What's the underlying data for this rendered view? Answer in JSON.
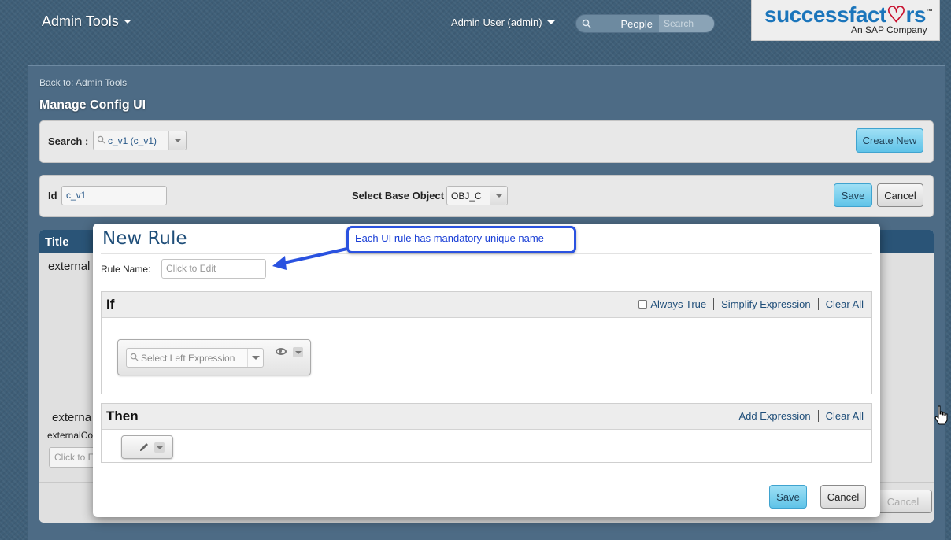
{
  "header": {
    "admin_tools": "Admin Tools",
    "user_menu": "Admin User (admin)",
    "people_label": "People",
    "search_placeholder": "Search",
    "logo_main_a": "successfact",
    "logo_main_b": "rs",
    "logo_sub": "An SAP Company"
  },
  "page": {
    "back_link": "Back to: Admin Tools",
    "title": "Manage Config UI"
  },
  "search_bar": {
    "label": "Search :",
    "value": "c_v1 (c_v1)",
    "create_new": "Create New"
  },
  "id_bar": {
    "id_label": "Id",
    "id_value": "c_v1",
    "base_object_label": "Select Base Object",
    "base_object_value": "OBJ_C",
    "save": "Save",
    "cancel": "Cancel"
  },
  "background_section": {
    "title": "Title",
    "external_1": "external",
    "external_2": "externa",
    "external_3": "externalCo",
    "input_placeholder": "Click to E",
    "cancel": "Cancel"
  },
  "modal": {
    "title": "New Rule",
    "rule_name_label": "Rule Name:",
    "rule_name_placeholder": "Click to Edit",
    "if_section": {
      "title": "If",
      "always_true": "Always True",
      "simplify": "Simplify Expression",
      "clear_all": "Clear All",
      "left_expression_placeholder": "Select Left Expression"
    },
    "then_section": {
      "title": "Then",
      "add_expression": "Add Expression",
      "clear_all": "Clear All"
    },
    "save": "Save",
    "cancel": "Cancel"
  },
  "callout": {
    "text": "Each UI rule has mandatory unique name",
    "color": "#2a52e0"
  },
  "colors": {
    "brand_blue": "#1b75bb",
    "header_bg": "#2a5477",
    "button_blue": "#5fc3e8"
  }
}
